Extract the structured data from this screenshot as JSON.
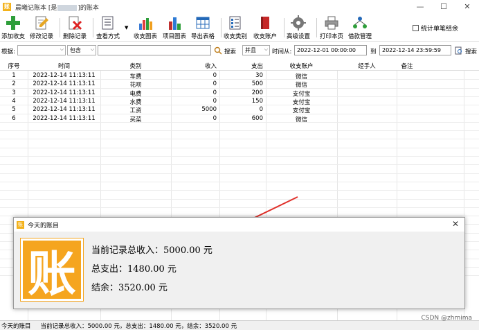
{
  "window": {
    "title_prefix": "晨曦记账本 [是",
    "title_suffix": "]的账本",
    "minimize": "—",
    "maximize": "☐",
    "close": "✕"
  },
  "toolbar": {
    "add": "添加收支",
    "edit": "修改记录",
    "delete": "删除记录",
    "view": "查看方式",
    "chart_income": "收支图表",
    "chart_item": "项目图表",
    "export": "导出表格",
    "category": "收支类别",
    "account": "收支账户",
    "settings": "高级设置",
    "print": "打印本页",
    "loan": "借款管理",
    "stat_single": "统计单笔结余"
  },
  "filter": {
    "basis_label": "根据:",
    "basis_value": "",
    "contain_value": "包含",
    "keyword": "",
    "search_label": "搜索",
    "logic_value": "并且",
    "time_from_label": "时间从:",
    "time_from": "2022-12-01 00:00:00",
    "to_label": "到",
    "time_to": "2022-12-14 23:59:59",
    "search2_label": "搜索"
  },
  "table": {
    "headers": [
      "序号",
      "时间",
      "类别",
      "收入",
      "支出",
      "收支账户",
      "经手人",
      "备注"
    ],
    "rows": [
      [
        "1",
        "2022-12-14 11:13:11",
        "车费",
        "0",
        "30",
        "微信",
        "",
        ""
      ],
      [
        "2",
        "2022-12-14 11:13:11",
        "花呗",
        "0",
        "500",
        "微信",
        "",
        ""
      ],
      [
        "3",
        "2022-12-14 11:13:11",
        "电费",
        "0",
        "200",
        "支付宝",
        "",
        ""
      ],
      [
        "4",
        "2022-12-14 11:13:11",
        "水费",
        "0",
        "150",
        "支付宝",
        "",
        ""
      ],
      [
        "5",
        "2022-12-14 11:13:11",
        "工资",
        "5000",
        "0",
        "支付宝",
        "",
        ""
      ],
      [
        "6",
        "2022-12-14 11:13:11",
        "买菜",
        "0",
        "600",
        "微信",
        "",
        ""
      ]
    ]
  },
  "popup": {
    "title": "今天的账目",
    "close": "✕",
    "logo_char": "账",
    "line1": "当前记录总收入：5000.00 元",
    "line2": "总支出：1480.00 元",
    "line3": "结余：3520.00 元"
  },
  "statusbar": {
    "left": "今天的账目",
    "summary": "当前记录总收入：5000.00 元，总支出：1480.00 元，结余：3520.00 元"
  },
  "watermark": "CSDN @zhmima",
  "colors": {
    "accent": "#f5a51f",
    "arrow": "#e0302a"
  }
}
